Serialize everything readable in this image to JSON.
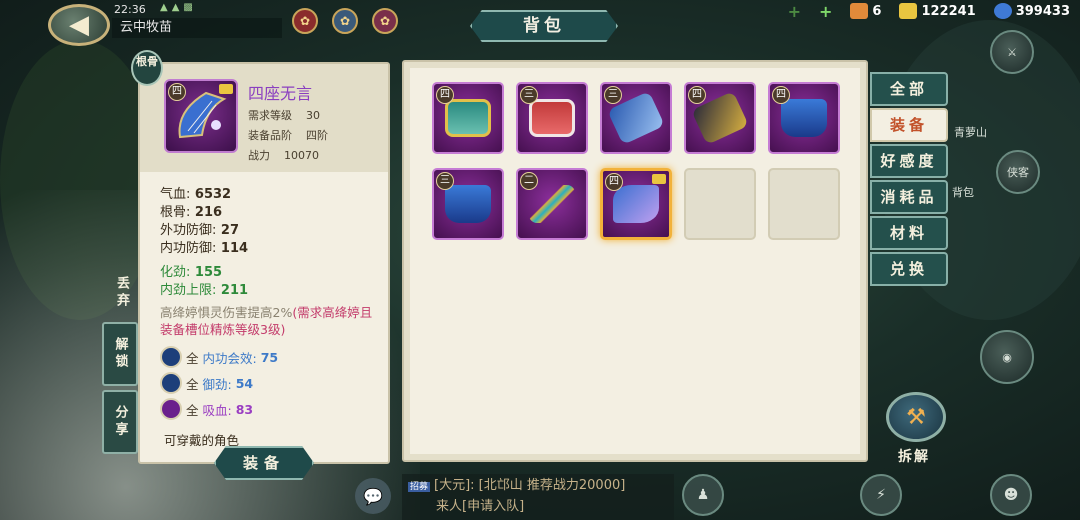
{
  "hud": {
    "clock": "22:36",
    "area_name": "云中牧苗",
    "back_icon": "back-arrow-icon"
  },
  "currency": {
    "item1_count": "6",
    "gold": "122241",
    "silver": "399433"
  },
  "title": "背包",
  "detail": {
    "gen_badge": "根骨",
    "tier": "四",
    "name": "四座无言",
    "meta": [
      {
        "k": "需求等级",
        "v": "30"
      },
      {
        "k": "装备品阶",
        "v": "四阶"
      },
      {
        "k": "战力",
        "v": "10070"
      }
    ],
    "stats": [
      {
        "k": "气血:",
        "v": "6532"
      },
      {
        "k": "根骨:",
        "v": "216"
      },
      {
        "k": "外功防御:",
        "v": "27"
      },
      {
        "k": "内功防御:",
        "v": "114"
      }
    ],
    "green_stats": [
      {
        "k": "化劲:",
        "v": "155"
      },
      {
        "k": "内劲上限:",
        "v": "211"
      }
    ],
    "effect": "高绛婷惧灵伤害提高2%",
    "effect_req": "(需求高绛婷且装备槽位精炼等级3级)",
    "gems": [
      {
        "all": "全",
        "name": "内功会效:",
        "value": "75",
        "color": "#1d3f7a"
      },
      {
        "all": "全",
        "name": "御劲:",
        "value": "54",
        "color": "#1d3f7a"
      },
      {
        "all": "全",
        "name": "吸血:",
        "value": "83",
        "color": "#6a1f8c"
      }
    ],
    "wearable": "可穿戴的角色"
  },
  "actions": {
    "discard": "丢弃",
    "unlock": "解锁",
    "share": "分享",
    "equip": "装备"
  },
  "inventory": {
    "slots": [
      {
        "tier": "四",
        "kind": "belt-teal"
      },
      {
        "tier": "三",
        "kind": "belt-red"
      },
      {
        "tier": "三",
        "kind": "bracer-blue"
      },
      {
        "tier": "四",
        "kind": "bracer-gold"
      },
      {
        "tier": "四",
        "kind": "boots-blue"
      },
      {
        "tier": "三",
        "kind": "boots-blue"
      },
      {
        "tier": "二",
        "kind": "spears-gold"
      },
      {
        "tier": "四",
        "kind": "harp-purple",
        "selected": true
      },
      {
        "tier": "",
        "kind": "empty"
      },
      {
        "tier": "",
        "kind": "empty"
      }
    ]
  },
  "tabs": [
    {
      "label": "全部",
      "active": false
    },
    {
      "label": "装备",
      "active": true
    },
    {
      "label": "好感度",
      "active": false
    },
    {
      "label": "消耗品",
      "active": false
    },
    {
      "label": "材料",
      "active": false
    },
    {
      "label": "兑换",
      "active": false
    }
  ],
  "right_side": {
    "dismantle": "拆解",
    "npc_label_1": "青萝山",
    "npc_label_2": "侠客",
    "npc_label_3": "背包"
  },
  "chat": {
    "tag": "招募",
    "line1": "[大元]: [北邙山 推荐战力20000]",
    "line2": "来人[申请入队]"
  }
}
